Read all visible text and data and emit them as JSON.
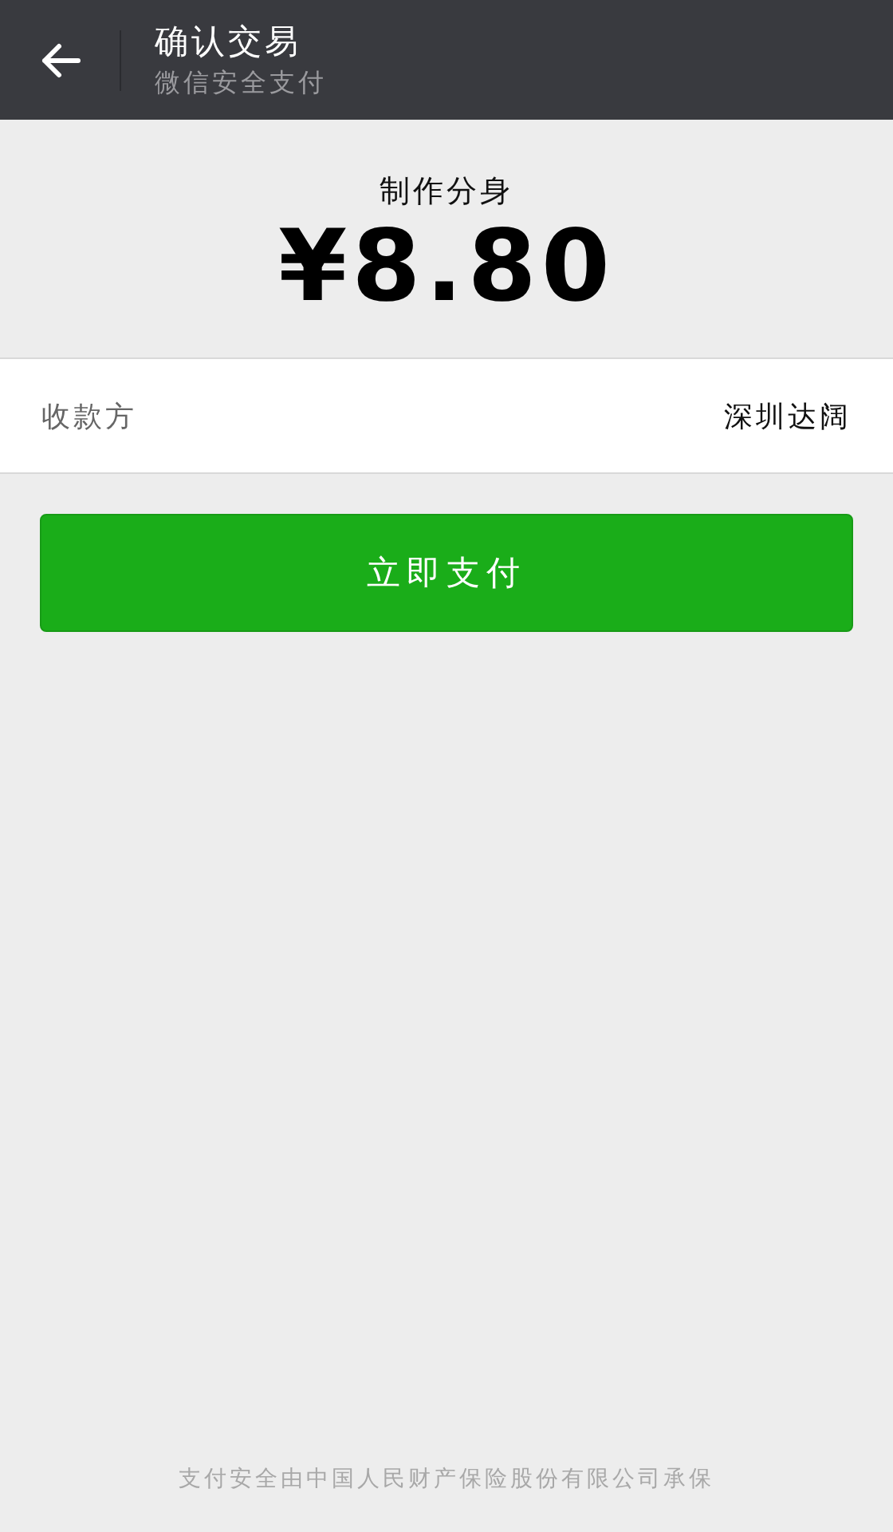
{
  "header": {
    "title": "确认交易",
    "subtitle": "微信安全支付"
  },
  "payment": {
    "product": "制作分身",
    "amount": "¥8.80"
  },
  "payee": {
    "label": "收款方",
    "value": "深圳达阔"
  },
  "pay_button": "立即支付",
  "footer": "支付安全由中国人民财产保险股份有限公司承保"
}
